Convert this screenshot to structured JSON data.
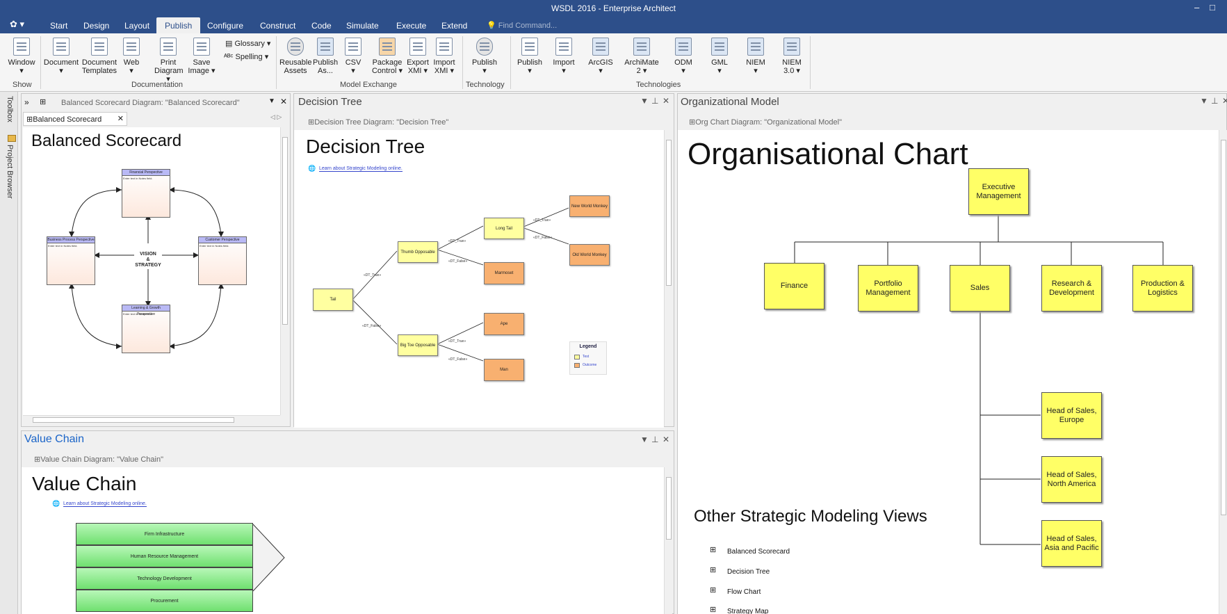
{
  "window": {
    "title": "WSDL 2016 - Enterprise Architect"
  },
  "menu": {
    "app_icon": "ea-logo-icon",
    "items": [
      "Start",
      "Design",
      "Layout",
      "Publish",
      "Configure",
      "Construct",
      "Code",
      "Simulate",
      "Execute",
      "Extend"
    ],
    "active": "Publish",
    "find_placeholder": "Find Command..."
  },
  "ribbon": {
    "buttons": [
      {
        "label1": "Window",
        "label2": "▾"
      },
      {
        "label1": "Document",
        "label2": "▾"
      },
      {
        "label1": "Document",
        "label2": "Templates"
      },
      {
        "label1": "Web",
        "label2": "▾"
      },
      {
        "label1": "Print",
        "label2": "Diagram ▾"
      },
      {
        "label1": "Save",
        "label2": "Image ▾"
      },
      {
        "label1": "Reusable",
        "label2": "Assets"
      },
      {
        "label1": "Publish",
        "label2": "As..."
      },
      {
        "label1": "CSV",
        "label2": "▾"
      },
      {
        "label1": "Package",
        "label2": "Control ▾"
      },
      {
        "label1": "Export",
        "label2": "XMI ▾"
      },
      {
        "label1": "Import",
        "label2": "XMI ▾"
      },
      {
        "label1": "Publish",
        "label2": "▾"
      },
      {
        "label1": "Publish",
        "label2": "▾"
      },
      {
        "label1": "Import",
        "label2": "▾"
      },
      {
        "label1": "ArcGIS",
        "label2": "▾"
      },
      {
        "label1": "ArchiMate",
        "label2": "2 ▾"
      },
      {
        "label1": "ODM",
        "label2": "▾"
      },
      {
        "label1": "GML",
        "label2": "▾"
      },
      {
        "label1": "NIEM",
        "label2": "▾"
      },
      {
        "label1": "NIEM",
        "label2": "3.0 ▾"
      }
    ],
    "small": {
      "glossary": "Glossary ▾",
      "spelling": "Spelling ▾"
    },
    "groups": {
      "show": "Show",
      "documentation": "Documentation",
      "model_exchange": "Model Exchange",
      "technology": "Technology",
      "technologies": "Technologies"
    }
  },
  "side": {
    "toolbox": "Toolbox",
    "project_browser": "Project Browser"
  },
  "balanced": {
    "header": "Balanced Scorecard Diagram: \"Balanced Scorecard\"",
    "tab": "Balanced Scorecard",
    "title": "Balanced Scorecard",
    "center1": "VISION",
    "center2": "&",
    "center3": "STRATEGY",
    "boxes": [
      {
        "name": "Financial Perspective",
        "note": "Enter text in Notes field."
      },
      {
        "name": "Business Process Perspective",
        "note": "Enter text in Notes field."
      },
      {
        "name": "Customer Perspective",
        "note": "Enter text in Notes field."
      },
      {
        "name": "Learning & Growth Perspective",
        "note": "Enter text in Notes field."
      }
    ]
  },
  "decision": {
    "panel_title": "Decision Tree",
    "diagram_label": "Decision Tree Diagram: \"Decision Tree\"",
    "title": "Decision Tree",
    "link": "Learn about Strategic Modeling online.",
    "nodes": {
      "tail": "Tail",
      "thumb": "Thumb Opposable",
      "bigtoe": "Big Toe Opposable",
      "longtail": "Long Tail",
      "marmoset": "Marmoset",
      "ape": "Ape",
      "man": "Man",
      "nwm": "New World Monkey",
      "owm": "Old World Monkey"
    },
    "labels": {
      "t": "«DT_True»",
      "f": "«DT_False»"
    },
    "legend": {
      "title": "Legend",
      "test": "Test",
      "outcome": "Outcome"
    }
  },
  "value": {
    "panel_title": "Value Chain",
    "diagram_label": "Value Chain Diagram: \"Value Chain\"",
    "title": "Value Chain",
    "link": "Learn about Strategic Modeling online.",
    "rows": [
      "Firm Infrastructure",
      "Human Resource Management",
      "Technology Development",
      "Procurement"
    ]
  },
  "org": {
    "panel_title": "Organizational Model",
    "diagram_label": "Org Chart Diagram: \"Organizational Model\"",
    "title": "Organisational Chart",
    "exec": "Executive Management",
    "depts": [
      "Finance",
      "Portfolio Management",
      "Sales",
      "Research & Development",
      "Production & Logistics"
    ],
    "heads": [
      "Head of Sales, Europe",
      "Head of Sales, North America",
      "Head of Sales, Asia and Pacific"
    ],
    "other_title": "Other Strategic Modeling Views",
    "other_items": [
      "Balanced Scorecard",
      "Decision Tree",
      "Flow Chart",
      "Strategy Map"
    ]
  },
  "colors": {
    "titlebar": "#2d4f8a",
    "org_box": "#ffff66",
    "dt_test": "#ffffa0",
    "dt_outcome": "#f8b070",
    "vc_green": "#6fe06f"
  }
}
